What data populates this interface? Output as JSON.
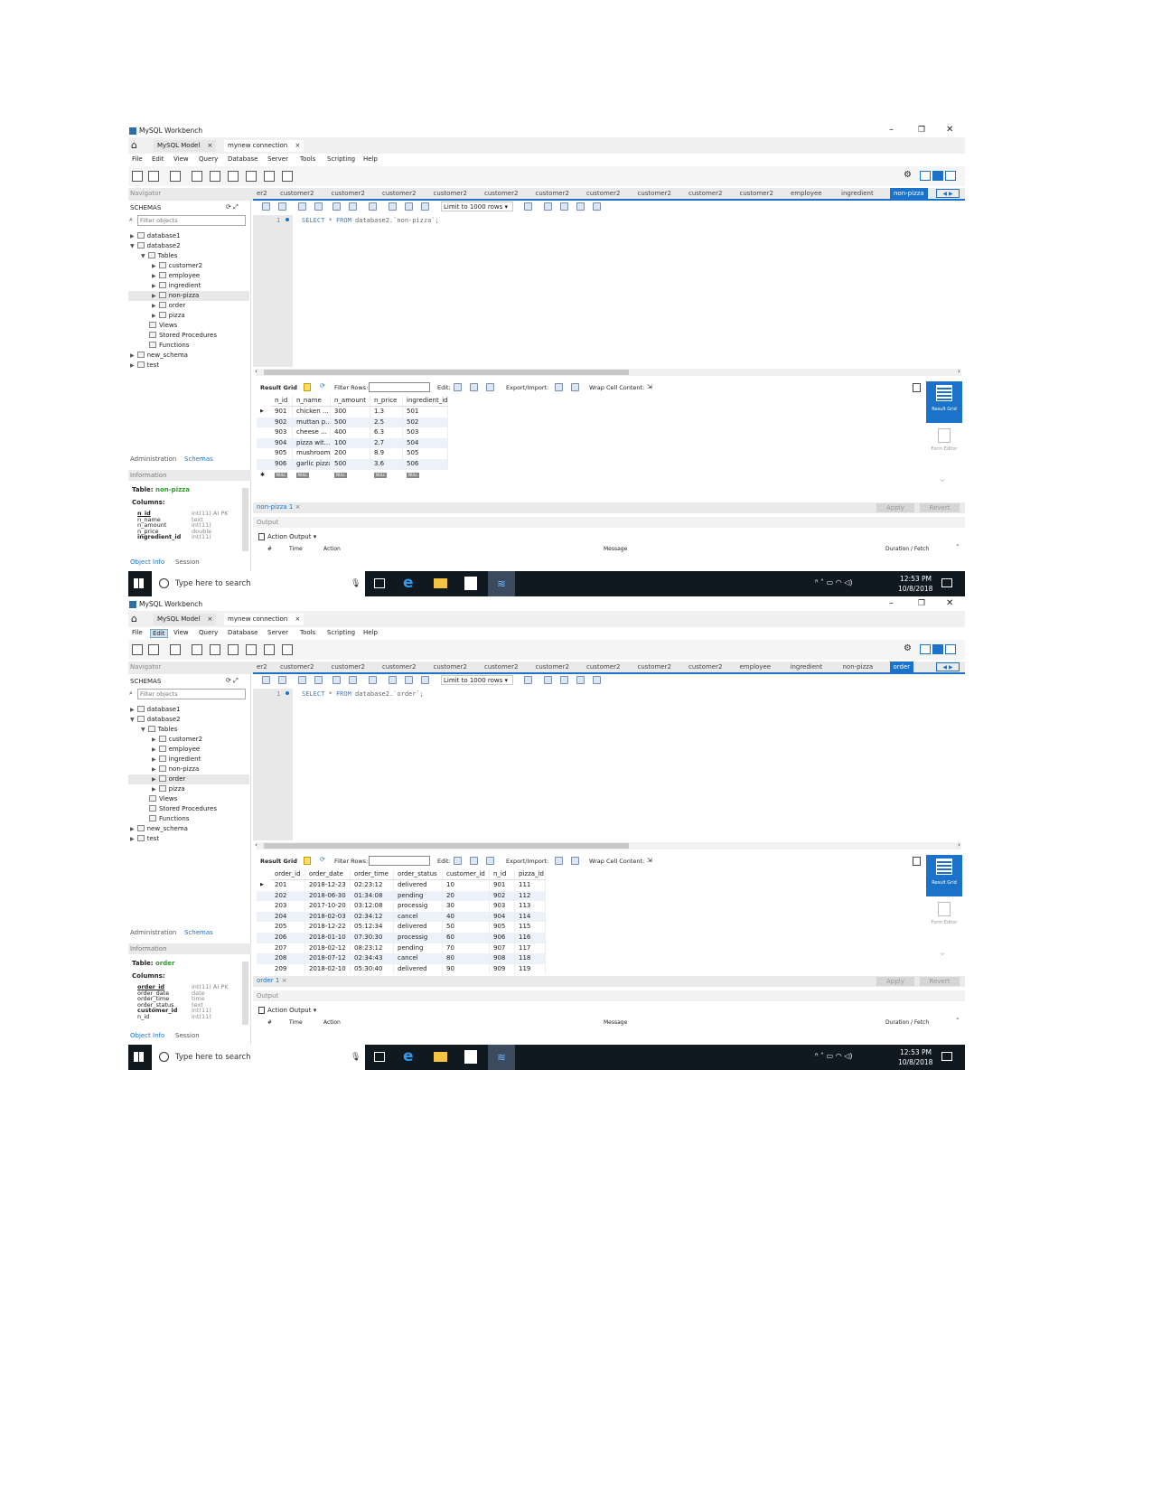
{
  "app_title": "MySQL Workbench",
  "top_tabs": [
    {
      "label": "MySQL Model",
      "close": "×"
    },
    {
      "label": "mynew connection",
      "close": "×"
    }
  ],
  "menu": [
    "File",
    "Edit",
    "View",
    "Query",
    "Database",
    "Server",
    "Tools",
    "Scripting",
    "Help"
  ],
  "navigator_label": "Navigator",
  "schemas_label": "SCHEMAS",
  "filter_placeholder": "Filter objects",
  "limit_label": "Limit to 1000 rows",
  "result_toolbar": {
    "result_grid": "Result Grid",
    "filter_rows": "Filter Rows:",
    "edit": "Edit:",
    "export_import": "Export/Import:",
    "wrap": "Wrap Cell Content:"
  },
  "side_buttons": {
    "result_grid": "Result Grid",
    "form_editor": "Form Editor"
  },
  "apply_label": "Apply",
  "revert_label": "Revert",
  "bottom_tabs": {
    "administration": "Administration",
    "schemas": "Schemas",
    "information": "Information",
    "object_info": "Object Info",
    "session": "Session"
  },
  "output": {
    "label": "Output",
    "action_output": "Action Output",
    "columns": [
      "#",
      "Time",
      "Action",
      "Message",
      "Duration / Fetch"
    ]
  },
  "taskbar": {
    "search": "Type here to search",
    "time": "12:53 PM",
    "date": "10/8/2018"
  },
  "colors": {
    "accent": "#1a73c8",
    "table_name": "#2e9a2e",
    "taskbar": "#101820"
  },
  "windows": [
    {
      "editor_tabs": [
        "er2",
        "customer2",
        "customer2",
        "customer2",
        "customer2",
        "customer2",
        "customer2",
        "customer2",
        "customer2",
        "customer2",
        "customer2",
        "employee",
        "ingredient",
        "non-pizza"
      ],
      "active_tab": 13,
      "tree": [
        {
          "label": "database1",
          "level": 0,
          "arrow": "▶"
        },
        {
          "label": "database2",
          "level": 0,
          "arrow": "▼"
        },
        {
          "label": "Tables",
          "level": 1,
          "arrow": "▼"
        },
        {
          "label": "customer2",
          "level": 2,
          "arrow": "▶"
        },
        {
          "label": "employee",
          "level": 2,
          "arrow": "▶"
        },
        {
          "label": "ingredient",
          "level": 2,
          "arrow": "▶"
        },
        {
          "label": "non-pizza",
          "level": 2,
          "arrow": "▶",
          "selected": true
        },
        {
          "label": "order",
          "level": 2,
          "arrow": "▶"
        },
        {
          "label": "pizza",
          "level": 2,
          "arrow": "▶"
        },
        {
          "label": "Views",
          "level": 1,
          "arrow": ""
        },
        {
          "label": "Stored Procedures",
          "level": 1,
          "arrow": ""
        },
        {
          "label": "Functions",
          "level": 1,
          "arrow": ""
        },
        {
          "label": "new_schema",
          "level": 0,
          "arrow": "▶"
        },
        {
          "label": "test",
          "level": 0,
          "arrow": "▶"
        }
      ],
      "query": {
        "keyword1": "SELECT",
        "rest1": " * ",
        "keyword2": "FROM",
        "rest2": " database2.`non-pizza`;"
      },
      "columns": [
        "n_id",
        "n_name",
        "n_amount",
        "n_price",
        "ingredient_id"
      ],
      "rows": [
        [
          "901",
          "chicken ...",
          "300",
          "1.3",
          "501"
        ],
        [
          "902",
          "muttan p...",
          "500",
          "2.5",
          "502"
        ],
        [
          "903",
          "cheese ...",
          "400",
          "6.3",
          "503"
        ],
        [
          "904",
          "pizza wit...",
          "100",
          "2.7",
          "504"
        ],
        [
          "905",
          "mushroom",
          "200",
          "8.9",
          "505"
        ],
        [
          "906",
          "garlic pizza",
          "500",
          "3.6",
          "506"
        ],
        [
          "NULL",
          "NULL",
          "NULL",
          "NULL",
          "NULL"
        ]
      ],
      "result_tab": "non-pizza 1",
      "info_table_label": "Table:",
      "info_table": "non-pizza",
      "info_columns_label": "Columns:",
      "info_columns": [
        [
          "n_id",
          "int(11) AI PK"
        ],
        [
          "n_name",
          "text"
        ],
        [
          "n_amount",
          "int(11)"
        ],
        [
          "n_price",
          "double"
        ],
        [
          "ingredient_id",
          "int(11)"
        ]
      ]
    },
    {
      "editor_tabs": [
        "er2",
        "customer2",
        "customer2",
        "customer2",
        "customer2",
        "customer2",
        "customer2",
        "customer2",
        "customer2",
        "customer2",
        "employee",
        "ingredient",
        "non-pizza",
        "order"
      ],
      "active_tab": 13,
      "tree": [
        {
          "label": "database1",
          "level": 0,
          "arrow": "▶"
        },
        {
          "label": "database2",
          "level": 0,
          "arrow": "▼"
        },
        {
          "label": "Tables",
          "level": 1,
          "arrow": "▼"
        },
        {
          "label": "customer2",
          "level": 2,
          "arrow": "▶"
        },
        {
          "label": "employee",
          "level": 2,
          "arrow": "▶"
        },
        {
          "label": "ingredient",
          "level": 2,
          "arrow": "▶"
        },
        {
          "label": "non-pizza",
          "level": 2,
          "arrow": "▶"
        },
        {
          "label": "order",
          "level": 2,
          "arrow": "▶",
          "selected": true
        },
        {
          "label": "pizza",
          "level": 2,
          "arrow": "▶"
        },
        {
          "label": "Views",
          "level": 1,
          "arrow": ""
        },
        {
          "label": "Stored Procedures",
          "level": 1,
          "arrow": ""
        },
        {
          "label": "Functions",
          "level": 1,
          "arrow": ""
        },
        {
          "label": "new_schema",
          "level": 0,
          "arrow": "▶"
        },
        {
          "label": "test",
          "level": 0,
          "arrow": "▶"
        }
      ],
      "query": {
        "keyword1": "SELECT",
        "rest1": " * ",
        "keyword2": "FROM",
        "rest2": " database2.`order`;"
      },
      "columns": [
        "order_id",
        "order_date",
        "order_time",
        "order_status",
        "customer_id",
        "n_id",
        "pizza_id"
      ],
      "rows": [
        [
          "201",
          "2018-12-23",
          "02:23:12",
          "delivered",
          "10",
          "901",
          "111"
        ],
        [
          "202",
          "2018-06-30",
          "01:34:08",
          "pending",
          "20",
          "902",
          "112"
        ],
        [
          "203",
          "2017-10-20",
          "03:12:08",
          "processig",
          "30",
          "903",
          "113"
        ],
        [
          "204",
          "2018-02-03",
          "02:34:12",
          "cancel",
          "40",
          "904",
          "114"
        ],
        [
          "205",
          "2018-12-22",
          "05:12:34",
          "delivered",
          "50",
          "905",
          "115"
        ],
        [
          "206",
          "2018-01-10",
          "07:30:30",
          "processig",
          "60",
          "906",
          "116"
        ],
        [
          "207",
          "2018-02-12",
          "08:23:12",
          "pending",
          "70",
          "907",
          "117"
        ],
        [
          "208",
          "2018-07-12",
          "02:34:43",
          "cancel",
          "80",
          "908",
          "118"
        ],
        [
          "209",
          "2018-02-10",
          "05:30:40",
          "delivered",
          "90",
          "909",
          "119"
        ]
      ],
      "result_tab": "order 1",
      "info_table_label": "Table:",
      "info_table": "order",
      "info_columns_label": "Columns:",
      "info_columns": [
        [
          "order_id",
          "int(11) AI PK"
        ],
        [
          "order_date",
          "date"
        ],
        [
          "order_time",
          "time"
        ],
        [
          "order_status",
          "text"
        ],
        [
          "customer_id",
          "int(11)"
        ],
        [
          "n_id",
          "int(11)"
        ]
      ]
    }
  ]
}
